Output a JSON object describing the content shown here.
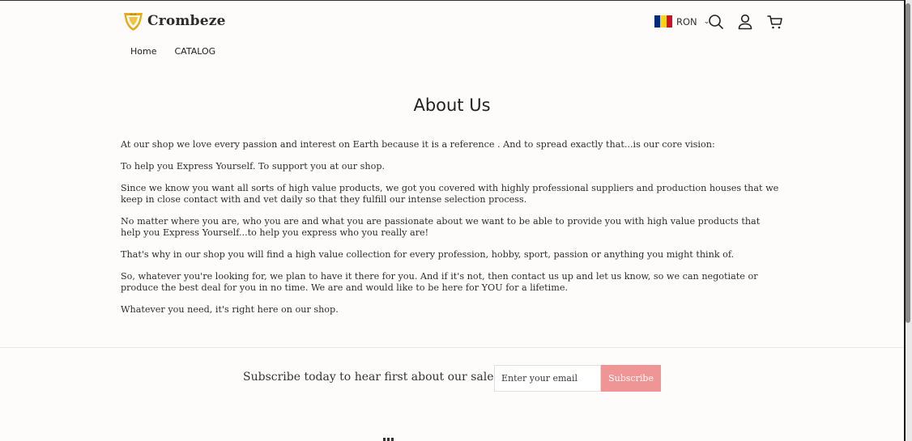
{
  "header": {
    "brand": "Crombeze",
    "logo_icon": "shield-crown-logo",
    "currency": {
      "code": "RON",
      "flag_colors": [
        "#002b7f",
        "#fcd116",
        "#ce1126"
      ]
    },
    "icons": [
      "search-icon",
      "account-icon",
      "cart-icon"
    ]
  },
  "nav": {
    "items": [
      "Home",
      "CATALOG"
    ]
  },
  "page": {
    "title": "About Us",
    "paragraphs": [
      "At our shop we love every passion and interest on Earth because it is a reference . And to spread exactly that...is our core vision:",
      "To help you Express Yourself. To support you at our shop.",
      "Since we know you want all sorts of high value products, we got you covered with highly professional suppliers and production houses that we keep in close contact with and vet daily so that they fulfill our intense selection process.",
      "No matter where you are, who you are and what you are passionate about we want to be able to provide you with high value products that help you Express Yourself...to help you express who you really are!",
      "That's why in our shop you will find a high value collection for every profession, hobby, sport, passion or anything you might think of.",
      "So, whatever you're looking for, we plan to have it there for you. And if it's not, then contact us up and let us know, so we can negotiate or produce the best deal for you in no time. We are and would like to be here for YOU for a lifetime.",
      "Whatever you need, it's right here on our shop."
    ]
  },
  "newsletter": {
    "text": "Subscribe today to hear first about our sales",
    "email_placeholder": "Enter your email",
    "button_label": "Subscribe",
    "button_color": "#f09595"
  }
}
